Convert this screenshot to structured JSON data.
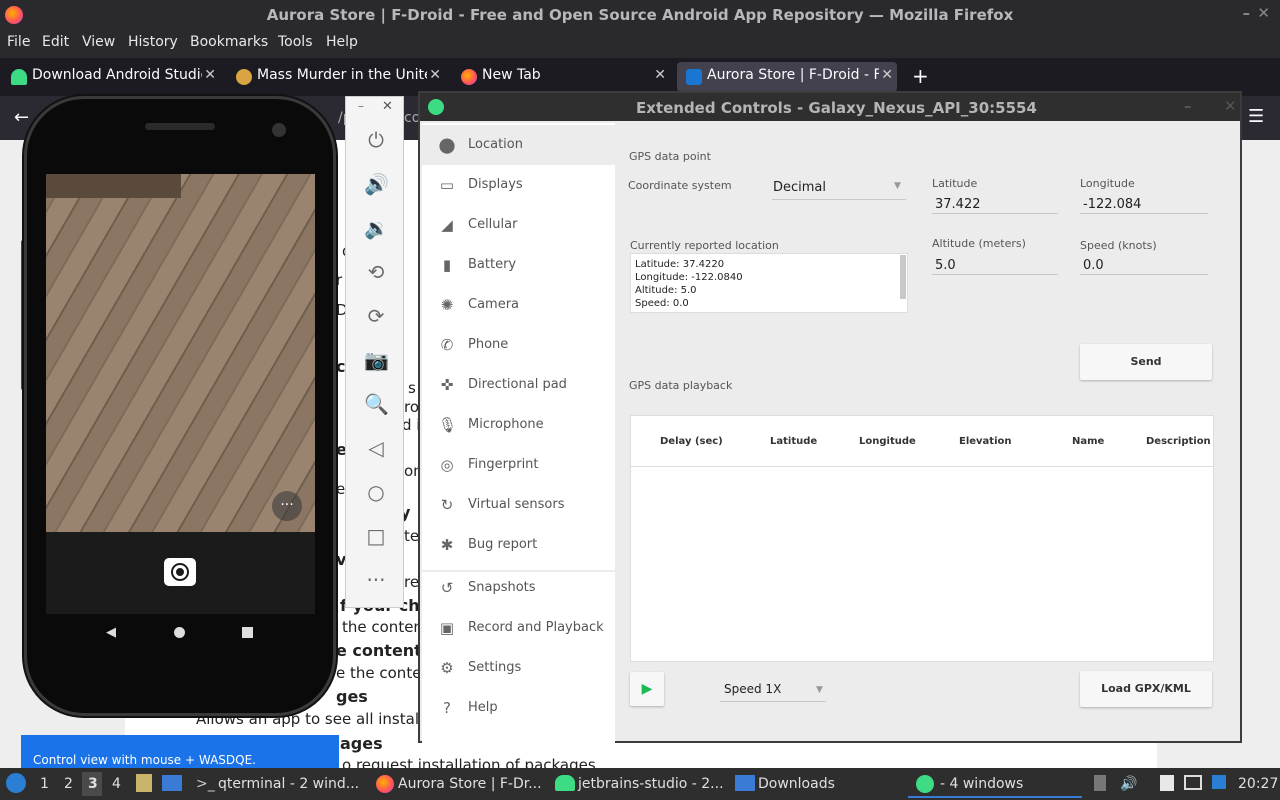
{
  "firefox": {
    "window_title": "Aurora Store | F-Droid - Free and Open Source Android App Repository — Mozilla Firefox",
    "menu": [
      "File",
      "Edit",
      "View",
      "History",
      "Bookmarks",
      "Tools",
      "Help"
    ],
    "tabs": [
      {
        "label": "Download Android Studio",
        "icon": "android-icon"
      },
      {
        "label": "Mass Murder in the Unite",
        "icon": "reddit-icon"
      },
      {
        "label": "New Tab",
        "icon": "firefox-icon"
      },
      {
        "label": "Aurora Store | F-Droid - Fr",
        "icon": "fdroid-icon",
        "active": true
      }
    ],
    "new_tab": "+",
    "url_fragment": "/pa",
    "url_fragment2": "co"
  },
  "page_fragments": {
    "f1": "do",
    "f2": "r n",
    "f3": "D",
    "f4": "l g",
    "f5": "c",
    "f6": "s",
    "f7": "ro",
    "f8": "d i",
    "f9": "e",
    "f10": "on",
    "f11": "ed",
    "f12": "y",
    "f13": "te",
    "f14": "vi",
    "f15": "re",
    "f16": "f your char",
    "f17": "the contents",
    "f18": "e contents",
    "f19": "e the content",
    "f20": "ges",
    "f21": "Allows an app to see all installed pa",
    "f22": "ages",
    "f23": "o request installation of packages."
  },
  "emulator": {
    "tooltip": "Control view with mouse + WASDQE.",
    "tools": [
      "power-icon",
      "volume-up-icon",
      "volume-down-icon",
      "rotate-left-icon",
      "rotate-right-icon",
      "screenshot-icon",
      "zoom-icon",
      "back-icon",
      "home-icon",
      "overview-icon",
      "more-icon"
    ],
    "overflow": "···"
  },
  "extended": {
    "title": "Extended Controls - Galaxy_Nexus_API_30:5554",
    "sidebar": [
      {
        "label": "Location",
        "icon": "location-pin-icon",
        "selected": true
      },
      {
        "label": "Displays",
        "icon": "display-icon"
      },
      {
        "label": "Cellular",
        "icon": "signal-icon"
      },
      {
        "label": "Battery",
        "icon": "battery-icon"
      },
      {
        "label": "Camera",
        "icon": "camera-aperture-icon"
      },
      {
        "label": "Phone",
        "icon": "phone-icon"
      },
      {
        "label": "Directional pad",
        "icon": "dpad-icon"
      },
      {
        "label": "Microphone",
        "icon": "microphone-icon"
      },
      {
        "label": "Fingerprint",
        "icon": "fingerprint-icon"
      },
      {
        "label": "Virtual sensors",
        "icon": "sensors-icon"
      },
      {
        "label": "Bug report",
        "icon": "bug-icon"
      },
      {
        "label": "Snapshots",
        "icon": "history-icon"
      },
      {
        "label": "Record and Playback",
        "icon": "record-icon"
      },
      {
        "label": "Settings",
        "icon": "gear-icon"
      },
      {
        "label": "Help",
        "icon": "help-icon"
      }
    ],
    "gps_point_label": "GPS data point",
    "coord_system_label": "Coordinate system",
    "coord_system_value": "Decimal",
    "latitude_label": "Latitude",
    "latitude_value": "37.422",
    "longitude_label": "Longitude",
    "longitude_value": "-122.084",
    "altitude_label": "Altitude (meters)",
    "altitude_value": "5.0",
    "speed_label": "Speed (knots)",
    "speed_value": "0.0",
    "reported_label": "Currently reported location",
    "reported_lines": [
      "Latitude: 37.4220",
      "Longitude: -122.0840",
      "Altitude: 5.0",
      "Speed: 0.0"
    ],
    "send_label": "Send",
    "playback_label": "GPS data playback",
    "columns": [
      "Delay (sec)",
      "Latitude",
      "Longitude",
      "Elevation",
      "Name",
      "Description"
    ],
    "speed_select": "Speed 1X",
    "load_label": "Load GPX/KML"
  },
  "taskbar": {
    "workspaces": [
      "1",
      "2",
      "3",
      "4"
    ],
    "items": [
      "qterminal - 2 wind...",
      "Aurora Store | F-Dr...",
      "jetbrains-studio - 2...",
      "Downloads",
      "- 4 windows"
    ],
    "clock": "20:27"
  }
}
